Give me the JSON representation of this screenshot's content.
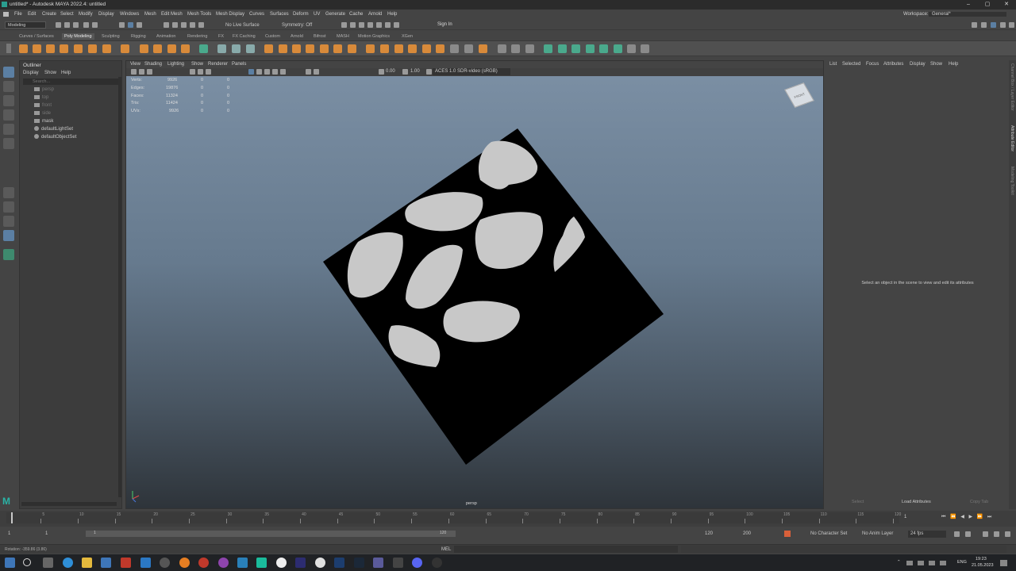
{
  "titlebar": {
    "title": "untitled* - Autodesk MAYA 2022.4: untitled"
  },
  "menubar": {
    "items": [
      "File",
      "Edit",
      "Create",
      "Select",
      "Modify",
      "Display",
      "Windows",
      "Mesh",
      "Edit Mesh",
      "Mesh Tools",
      "Mesh Display",
      "Curves",
      "Surfaces",
      "Deform",
      "UV",
      "Generate",
      "Cache",
      "Arnold",
      "Help"
    ],
    "workspace_label": "Workspace:",
    "workspace_value": "General*"
  },
  "statusline": {
    "mode": "Modeling",
    "live_surface": "No Live Surface",
    "symmetry": "Symmetry: Off",
    "sign_in": "Sign In"
  },
  "shelf_tabs": [
    "Curves / Surfaces",
    "Poly Modeling",
    "Sculpting",
    "Rigging",
    "Animation",
    "Rendering",
    "FX",
    "FX Caching",
    "Custom",
    "Arnold",
    "Bifrost",
    "MASH",
    "Motion Graphics",
    "XGen"
  ],
  "active_shelf": "Poly Modeling",
  "outliner": {
    "title": "Outliner",
    "menu": [
      "Display",
      "Show",
      "Help"
    ],
    "search_placeholder": "Search...",
    "items": [
      {
        "label": "persp",
        "dim": true
      },
      {
        "label": "top",
        "dim": true
      },
      {
        "label": "front",
        "dim": true
      },
      {
        "label": "side",
        "dim": true
      },
      {
        "label": "mask",
        "dim": false
      },
      {
        "label": "defaultLightSet",
        "dim": false
      },
      {
        "label": "defaultObjectSet",
        "dim": false
      }
    ]
  },
  "viewport": {
    "menu": [
      "View",
      "Shading",
      "Lighting",
      "Show",
      "Renderer",
      "Panels"
    ],
    "exposure": "0.00",
    "gamma": "1.00",
    "colorspace": "ACES 1.0 SDR-video (sRGB)",
    "hud": [
      {
        "label": "Verts:",
        "v1": "9926",
        "v2": "0",
        "v3": "0"
      },
      {
        "label": "Edges:",
        "v1": "19876",
        "v2": "0",
        "v3": "0"
      },
      {
        "label": "Faces:",
        "v1": "11324",
        "v2": "0",
        "v3": "0"
      },
      {
        "label": "Tris:",
        "v1": "11424",
        "v2": "0",
        "v3": "0"
      },
      {
        "label": "UVs:",
        "v1": "9926",
        "v2": "0",
        "v3": "0"
      }
    ],
    "camera_label": "persp",
    "viewcube_label": "FRONT"
  },
  "attribute_editor": {
    "menu": [
      "List",
      "Selected",
      "Focus",
      "Attributes",
      "Display",
      "Show",
      "Help"
    ],
    "empty_message": "Select an object in the scene to view and edit its attributes",
    "select_button": "Select",
    "load_button": "Load Attributes",
    "copy_button": "Copy Tab"
  },
  "side_tabs": [
    "Channel Box / Layer Editor",
    "Attribute Editor",
    "Modeling Toolkit"
  ],
  "timeline": {
    "current_frame": "1",
    "start": "1",
    "range_start": "1",
    "range_end": "120",
    "end": "120",
    "max_end": "200",
    "character_set": "No Character Set",
    "anim_layer": "No Anim Layer",
    "fps": "24 fps",
    "ticks": [
      "5",
      "10",
      "15",
      "20",
      "25",
      "30",
      "35",
      "40",
      "45",
      "50",
      "55",
      "60",
      "65",
      "70",
      "75",
      "80",
      "85",
      "90",
      "95",
      "100",
      "105",
      "110",
      "115",
      "120"
    ]
  },
  "command_line": {
    "status": "Rotation: -359.86 (3.86)",
    "mel_label": "MEL"
  },
  "taskbar": {
    "language": "ENG",
    "time": "19:23",
    "date": "21.05.2023"
  },
  "colors": {
    "shelf_icon_orange": "#d88a3a",
    "shelf_icon_teal": "#4aa98c",
    "selection_blue": "#5b7fa3",
    "mesh_black": "#000000",
    "leaf_grey": "#c8c8c8"
  }
}
